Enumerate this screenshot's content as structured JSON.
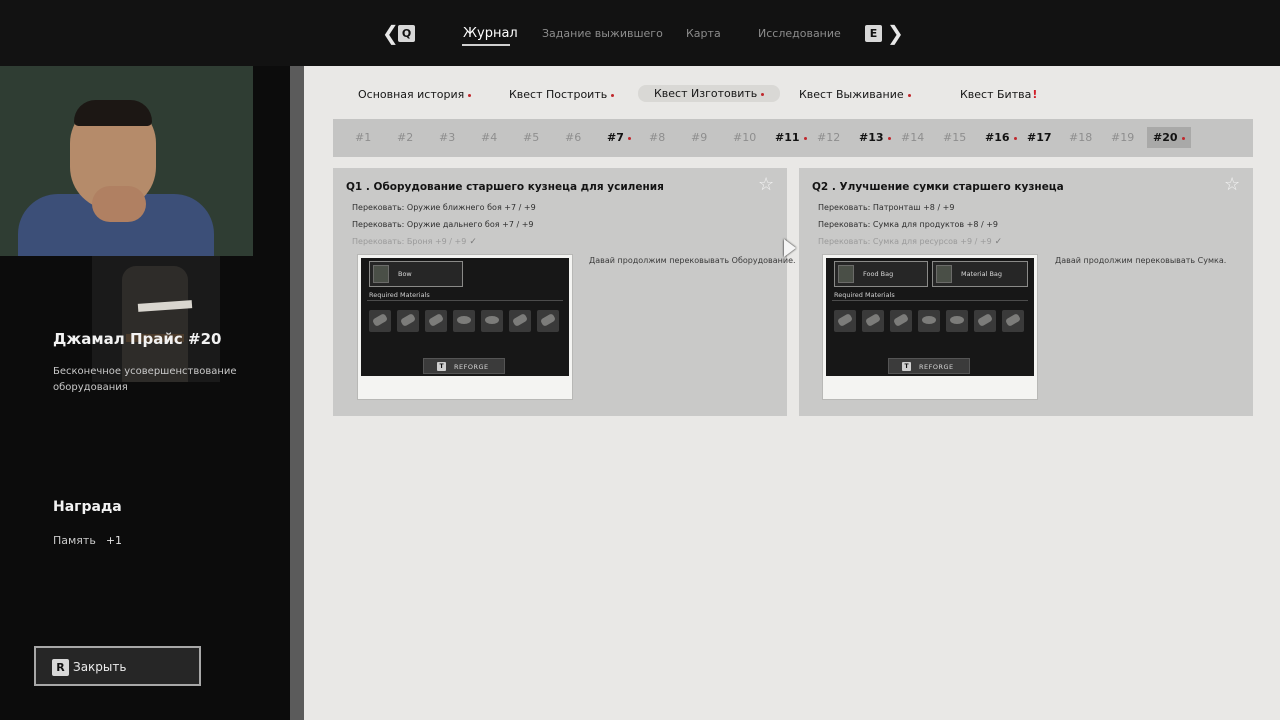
{
  "topbar": {
    "prev_key": "Q",
    "next_key": "E",
    "tabs": [
      {
        "label": "Журнал",
        "active": true
      },
      {
        "label": "Задание выжившего",
        "active": false
      },
      {
        "label": "Карта",
        "active": false
      },
      {
        "label": "Исследование",
        "active": false
      }
    ]
  },
  "sidebar": {
    "title": "Джамал Прайс #20",
    "description": "Бесконечное усовершенствование оборудования",
    "reward_heading": "Награда",
    "reward_item": "Память",
    "reward_amount": "+1",
    "close_key": "R",
    "close_label": "Закрыть"
  },
  "categories": [
    {
      "label": "Основная история",
      "marker": "dot",
      "active": false
    },
    {
      "label": "Квест Построить",
      "marker": "dot",
      "active": false
    },
    {
      "label": "Квест Изготовить",
      "marker": "dot",
      "active": true
    },
    {
      "label": "Квест Выживание",
      "marker": "dot",
      "active": false
    },
    {
      "label": "Квест Битва",
      "marker": "!",
      "active": false
    }
  ],
  "quest_numbers": [
    {
      "label": "#1",
      "state": "locked"
    },
    {
      "label": "#2",
      "state": "locked"
    },
    {
      "label": "#3",
      "state": "locked"
    },
    {
      "label": "#4",
      "state": "locked"
    },
    {
      "label": "#5",
      "state": "locked"
    },
    {
      "label": "#6",
      "state": "locked"
    },
    {
      "label": "#7",
      "state": "done",
      "dot": true
    },
    {
      "label": "#8",
      "state": "locked"
    },
    {
      "label": "#9",
      "state": "locked"
    },
    {
      "label": "#10",
      "state": "locked"
    },
    {
      "label": "#11",
      "state": "done",
      "dot": true
    },
    {
      "label": "#12",
      "state": "locked"
    },
    {
      "label": "#13",
      "state": "done",
      "dot": true
    },
    {
      "label": "#14",
      "state": "locked"
    },
    {
      "label": "#15",
      "state": "locked"
    },
    {
      "label": "#16",
      "state": "done",
      "dot": true
    },
    {
      "label": "#17",
      "state": "done"
    },
    {
      "label": "#18",
      "state": "locked"
    },
    {
      "label": "#19",
      "state": "locked"
    },
    {
      "label": "#20",
      "state": "active",
      "dot": true
    }
  ],
  "quests": [
    {
      "title": "Q1 . Оборудование старшего кузнеца для усиления",
      "tasks": [
        {
          "text": "Перековать: Оружие ближнего боя +7  / +9",
          "faded": false
        },
        {
          "text": "Перековать: Оружие дальнего боя +7  / +9",
          "faded": false
        },
        {
          "text": "Перековать: Броня +9  / +9",
          "faded": true
        }
      ],
      "note": "Давай продолжим перековывать Оборудование.",
      "slots": [
        "Bow"
      ],
      "required_label": "Required Materials",
      "reforge_key": "T",
      "reforge_label": "REFORGE"
    },
    {
      "title": "Q2 . Улучшение сумки старшего кузнеца",
      "tasks": [
        {
          "text": "Перековать: Патронташ +8  / +9",
          "faded": false
        },
        {
          "text": "Перековать: Сумка для продуктов +8  / +9",
          "faded": false
        },
        {
          "text": "Перековать: Сумка для ресурсов +9  / +9",
          "faded": true
        }
      ],
      "note": "Давай продолжим перековывать Сумка.",
      "slots": [
        "Food Bag",
        "Material Bag"
      ],
      "required_label": "Required Materials",
      "reforge_key": "T",
      "reforge_label": "REFORGE"
    }
  ]
}
